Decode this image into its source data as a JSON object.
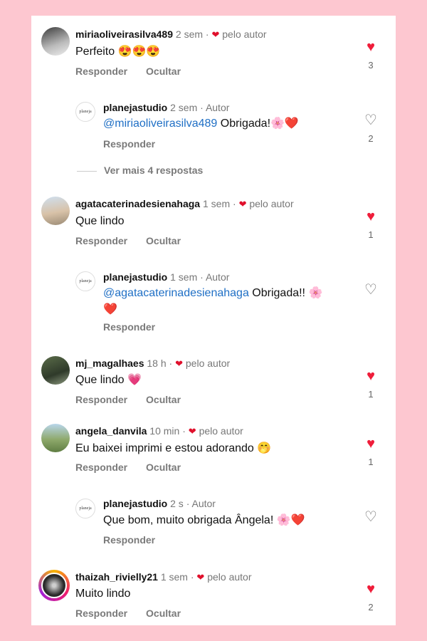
{
  "colors": {
    "background": "#fdc7d0",
    "panel": "#ffffff",
    "like": "#ef1d3a",
    "mention": "#1f6fc5"
  },
  "actions": {
    "reply": "Responder",
    "hide": "Ocultar"
  },
  "comments": [
    {
      "user": "miriaoliveirasilva489",
      "time": "2 sem",
      "liked_by_author": "pelo autor",
      "text": "Perfeito 😍😍😍",
      "likes": "3"
    },
    {
      "user": "planejastudio",
      "time": "2 sem",
      "badge": "Autor",
      "mention": "@miriaoliveirasilva489",
      "text": " Obrigada!🌸❤️",
      "likes": "2"
    },
    {
      "user": "agatacaterinadesienahaga",
      "time": "1 sem",
      "liked_by_author": "pelo autor",
      "text": "Que lindo",
      "likes": "1"
    },
    {
      "user": "planejastudio",
      "time": "1 sem",
      "badge": "Autor",
      "mention": "@agatacaterinadesienahaga",
      "text": " Obrigada!! 🌸",
      "text2": "❤️"
    },
    {
      "user": "mj_magalhaes",
      "time": "18 h",
      "liked_by_author": "pelo autor",
      "text": "Que lindo 💗",
      "likes": "1"
    },
    {
      "user": "angela_danvila",
      "time": "10 min",
      "liked_by_author": "pelo autor",
      "text": "Eu baixei imprimi e estou adorando 🤭",
      "likes": "1"
    },
    {
      "user": "planejastudio",
      "time": "2 s",
      "badge": "Autor",
      "text": "Que bom, muito obrigada Ângela! 🌸❤️"
    },
    {
      "user": "thaizah_rivielly21",
      "time": "1 sem",
      "liked_by_author": "pelo autor",
      "text": "Muito lindo",
      "likes": "2"
    }
  ],
  "more_replies": "Ver mais 4 respostas",
  "avatar_logo_text": "planeja"
}
